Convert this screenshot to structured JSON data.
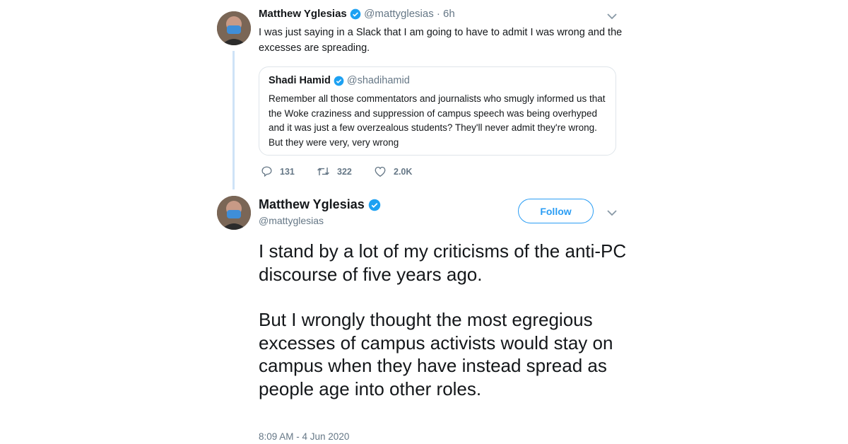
{
  "tweet1": {
    "author_name": "Matthew Yglesias",
    "handle": "@mattyglesias",
    "time": "· 6h",
    "text": "I was just saying in a Slack that I am going to have to admit I was wrong and the excesses are spreading.",
    "quote": {
      "author_name": "Shadi Hamid",
      "handle": "@shadihamid",
      "text": "Remember all those commentators and journalists who smugly informed us that the Woke craziness and suppression of campus speech was being overhyped and it was just a few overzealous students? They'll never admit they're wrong. But they were very, very wrong"
    },
    "actions": {
      "replies": "131",
      "retweets": "322",
      "likes": "2.0K"
    }
  },
  "tweet2": {
    "author_name": "Matthew Yglesias",
    "handle": "@mattyglesias",
    "follow_label": "Follow",
    "paragraph1": "I stand by a lot of my criticisms of the anti-PC discourse of five years ago.",
    "paragraph2": "But I wrongly thought the most egregious excesses of campus activists would stay on campus when they have instead spread as people age into other roles.",
    "timestamp": "8:09 AM - 4 Jun 2020"
  },
  "colors": {
    "accent": "#1da1f2",
    "muted": "#657786",
    "thread_line": "#cfe3f7"
  },
  "icons": [
    "verified-badge-icon",
    "chevron-down-icon",
    "reply-icon",
    "retweet-icon",
    "like-icon"
  ]
}
